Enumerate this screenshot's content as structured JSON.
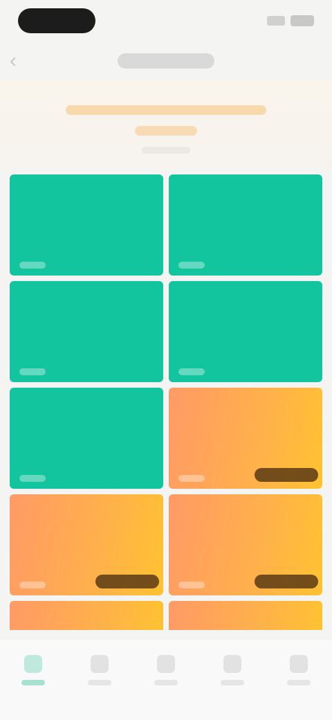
{
  "status_bar": {
    "time": "",
    "battery": ""
  },
  "nav": {
    "title": "",
    "back_icon": "chevron-left-icon"
  },
  "banner": {
    "line1": "",
    "line2": "",
    "line3": ""
  },
  "cards": [
    {
      "theme": "green",
      "label": "",
      "badge": false
    },
    {
      "theme": "green",
      "label": "",
      "badge": false
    },
    {
      "theme": "green",
      "label": "",
      "badge": false
    },
    {
      "theme": "green",
      "label": "",
      "badge": false
    },
    {
      "theme": "green",
      "label": "",
      "badge": false
    },
    {
      "theme": "orange",
      "label": "",
      "badge": true
    },
    {
      "theme": "orange",
      "label": "",
      "badge": true
    },
    {
      "theme": "orange",
      "label": "",
      "badge": true
    },
    {
      "theme": "orange",
      "label": "",
      "badge": false
    },
    {
      "theme": "orange",
      "label": "",
      "badge": false
    }
  ],
  "colors": {
    "green": "#13c59e",
    "orange_start": "#ff9a66",
    "orange_end": "#ffc231"
  },
  "tabs": [
    {
      "label": "",
      "icon": "home-icon",
      "active": true
    },
    {
      "label": "",
      "icon": "grid-icon",
      "active": false
    },
    {
      "label": "",
      "icon": "plus-icon",
      "active": false
    },
    {
      "label": "",
      "icon": "message-icon",
      "active": false
    },
    {
      "label": "",
      "icon": "user-icon",
      "active": false
    }
  ]
}
